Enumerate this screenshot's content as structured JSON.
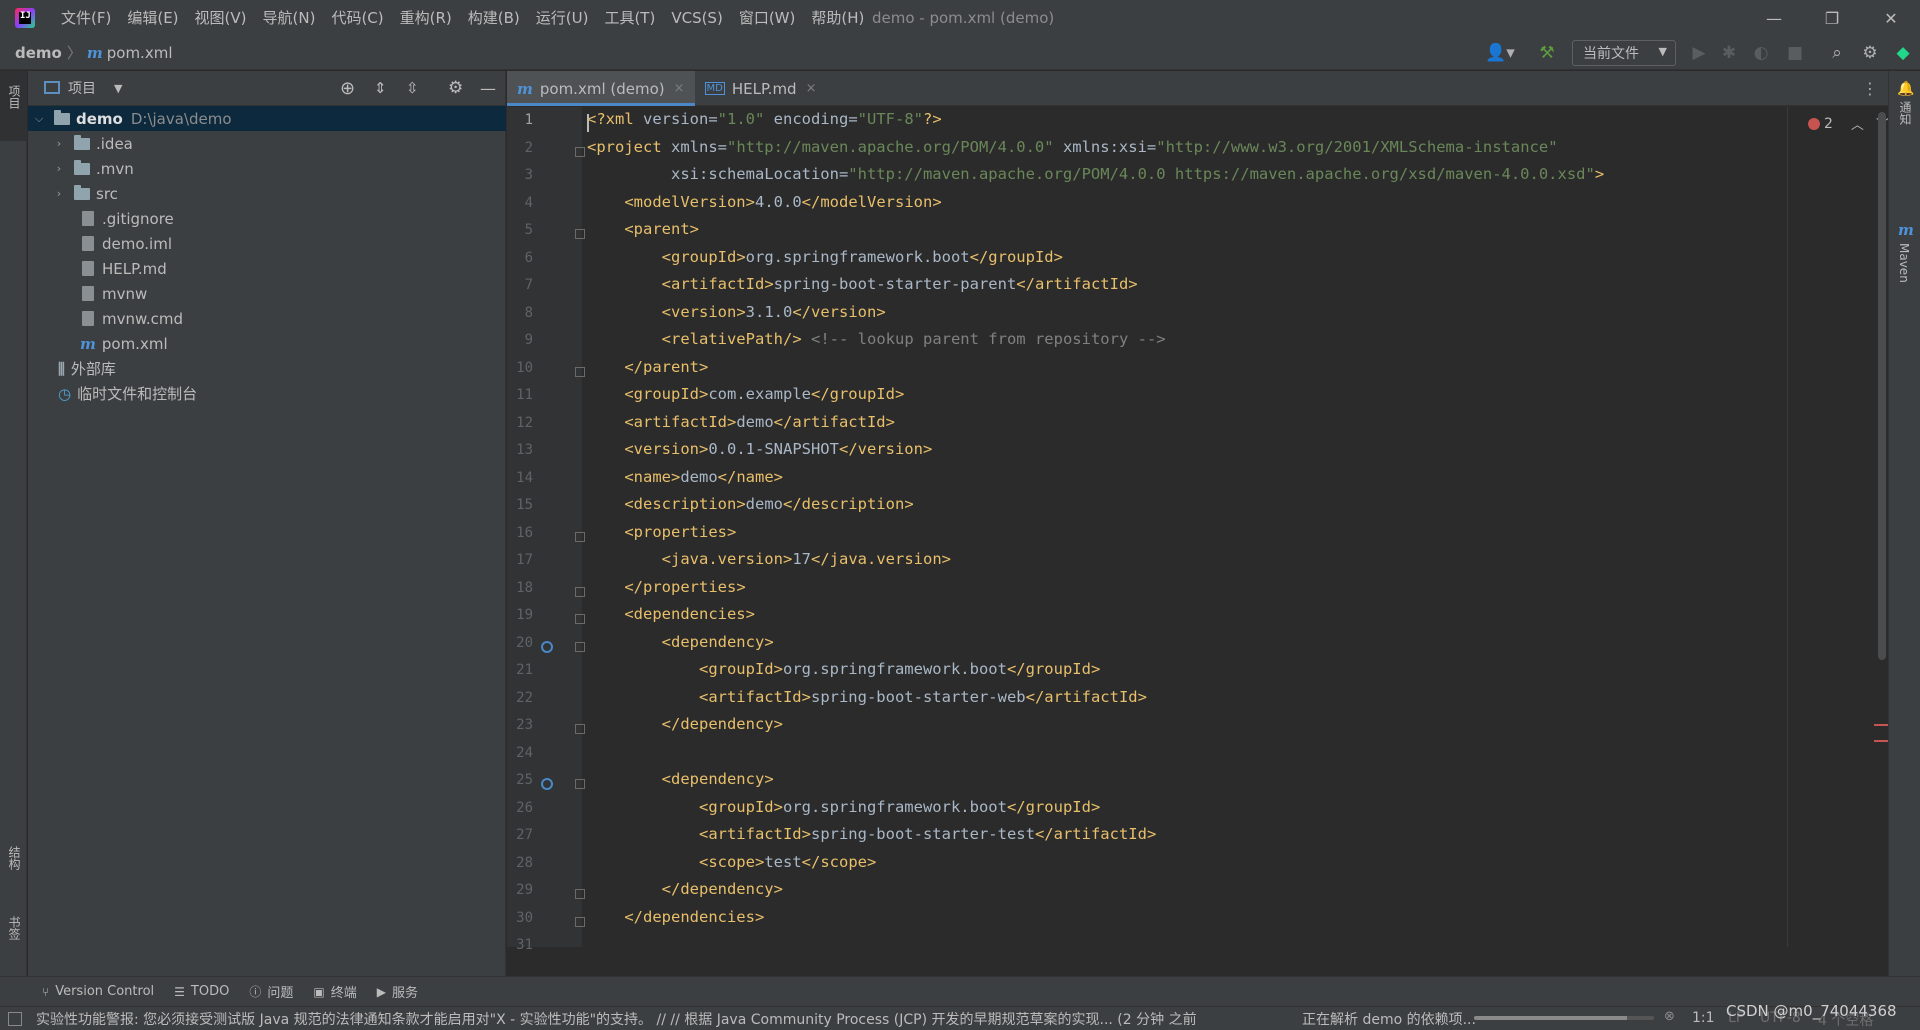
{
  "window": {
    "menu": [
      "文件(F)",
      "编辑(E)",
      "视图(V)",
      "导航(N)",
      "代码(C)",
      "重构(R)",
      "构建(B)",
      "运行(U)",
      "工具(T)",
      "VCS(S)",
      "窗口(W)",
      "帮助(H)"
    ],
    "title": "demo - pom.xml (demo)"
  },
  "navbar": {
    "project": "demo",
    "file": "pom.xml",
    "run_config": "当前文件"
  },
  "left_stripe": {
    "project": "项目",
    "structure": "结构",
    "bookmarks": "书签"
  },
  "right_stripe": {
    "notifications": "通知",
    "maven": "Maven",
    "maven_icon_letter": "m"
  },
  "project_panel": {
    "title": "项目",
    "root": {
      "name": "demo",
      "path": "D:\\java\\demo"
    },
    "items": [
      ".idea",
      ".mvn",
      "src",
      ".gitignore",
      "demo.iml",
      "HELP.md",
      "mvnw",
      "mvnw.cmd",
      "pom.xml"
    ],
    "external_libs": "外部库",
    "scratches": "临时文件和控制台"
  },
  "tabs": [
    {
      "label": "pom.xml (demo)",
      "active": true
    },
    {
      "label": "HELP.md",
      "active": false
    }
  ],
  "editor": {
    "error_count": "2",
    "line_numbers": [
      "1",
      "2",
      "3",
      "4",
      "5",
      "6",
      "7",
      "8",
      "9",
      "10",
      "11",
      "12",
      "13",
      "14",
      "15",
      "16",
      "17",
      "18",
      "19",
      "20",
      "21",
      "22",
      "23",
      "24",
      "25",
      "26",
      "27",
      "28",
      "29",
      "30",
      "31"
    ],
    "lines": [
      "<?xml version=\"1.0\" encoding=\"UTF-8\"?>",
      "<project xmlns=\"http://maven.apache.org/POM/4.0.0\" xmlns:xsi=\"http://www.w3.org/2001/XMLSchema-instance\"",
      "         xsi:schemaLocation=\"http://maven.apache.org/POM/4.0.0 https://maven.apache.org/xsd/maven-4.0.0.xsd\">",
      "    <modelVersion>4.0.0</modelVersion>",
      "    <parent>",
      "        <groupId>org.springframework.boot</groupId>",
      "        <artifactId>spring-boot-starter-parent</artifactId>",
      "        <version>3.1.0</version>",
      "        <relativePath/> <!-- lookup parent from repository -->",
      "    </parent>",
      "    <groupId>com.example</groupId>",
      "    <artifactId>demo</artifactId>",
      "    <version>0.0.1-SNAPSHOT</version>",
      "    <name>demo</name>",
      "    <description>demo</description>",
      "    <properties>",
      "        <java.version>17</java.version>",
      "    </properties>",
      "    <dependencies>",
      "        <dependency>",
      "            <groupId>org.springframework.boot</groupId>",
      "            <artifactId>spring-boot-starter-web</artifactId>",
      "        </dependency>",
      "",
      "        <dependency>",
      "            <groupId>org.springframework.boot</groupId>",
      "            <artifactId>spring-boot-starter-test</artifactId>",
      "            <scope>test</scope>",
      "        </dependency>",
      "    </dependencies>",
      ""
    ]
  },
  "tool_windows": [
    "Version Control",
    "TODO",
    "问题",
    "终端",
    "服务"
  ],
  "status": {
    "message": "实验性功能警报: 您必须接受测试版 Java 规范的法律通知条款才能启用对\"X - 实验性功能\"的支持。 // // 根据 Java Community Process (JCP) 开发的早期规范草案的实现... (2 分钟 之前",
    "task": "正在解析 demo 的依赖项...",
    "progress": 0.85,
    "caret": "1:1",
    "line_sep": "LF",
    "encoding": "UTF-8",
    "indent": "4 个空格",
    "watermark": "CSDN @m0_74044368"
  },
  "colors": {
    "accent": "#4a88c7",
    "tag": "#e8bf6a",
    "string": "#6a8759",
    "comment": "#808080",
    "error": "#c75450"
  }
}
